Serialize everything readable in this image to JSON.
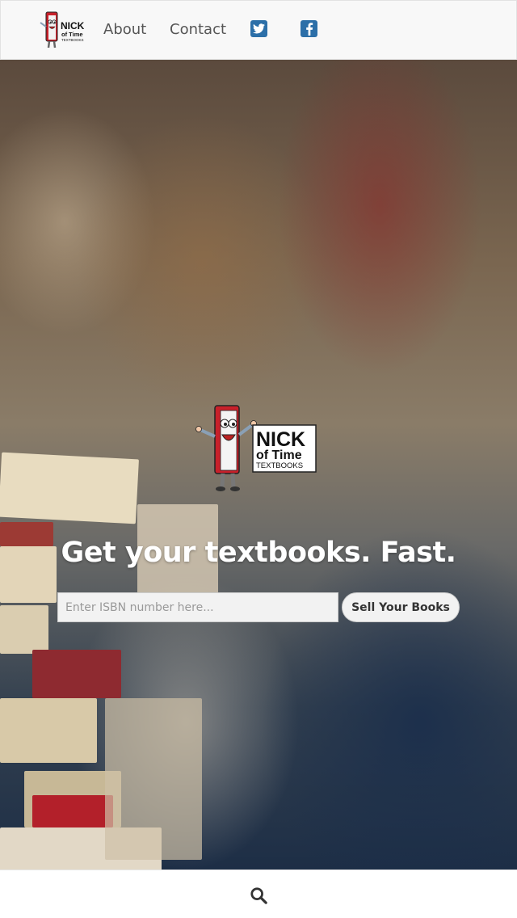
{
  "nav": {
    "logo_line1": "NICK",
    "logo_line2": "of Time",
    "logo_line3": "TEXTBOOKS",
    "about": "About",
    "contact": "Contact",
    "social_icons": [
      "twitter-icon",
      "facebook-icon"
    ]
  },
  "hero": {
    "logo_line1": "NICK",
    "logo_line2": "of Time",
    "logo_line3": "TEXTBOOKS",
    "headline": "Get your textbooks. Fast.",
    "isbn_placeholder": "Enter ISBN number here...",
    "sell_button": "Sell Your Books"
  },
  "bottom_bar": {
    "search_icon": "search-icon"
  },
  "colors": {
    "nav_bg": "#f8f8f8",
    "link": "#555555",
    "social": "#2c6fa8",
    "book_red": "#c8202a"
  }
}
